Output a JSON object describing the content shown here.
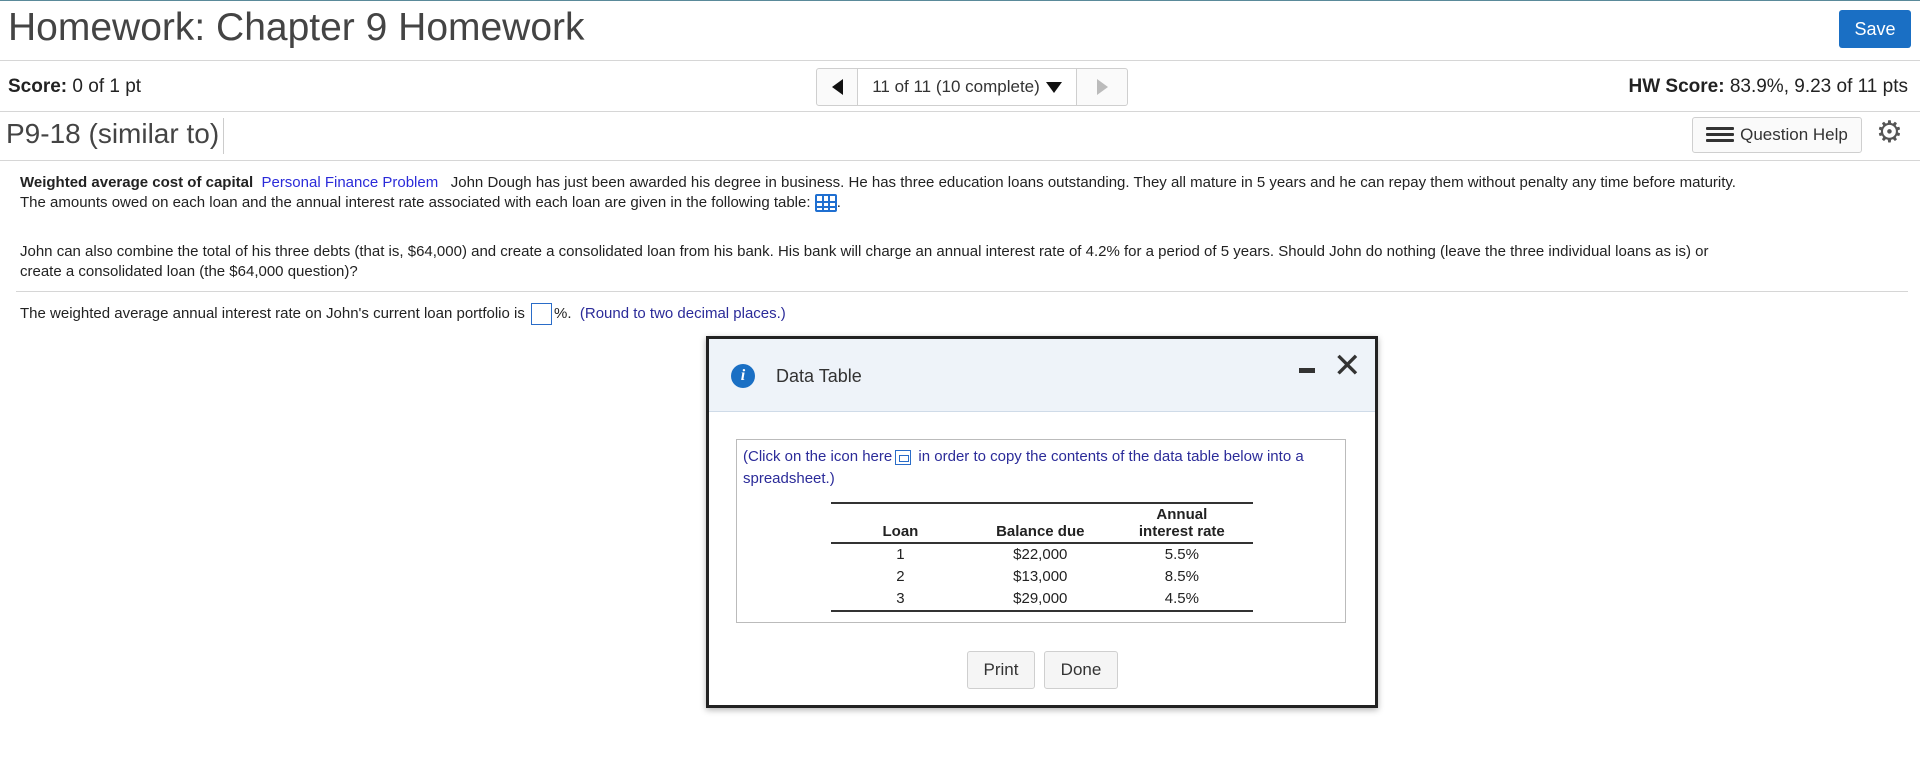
{
  "header": {
    "title": "Homework: Chapter 9 Homework",
    "save_label": "Save"
  },
  "score_row": {
    "score_label": "Score:",
    "score_value": "0 of 1 pt",
    "nav_text": "11 of 11 (10 complete)",
    "hw_label": "HW Score:",
    "hw_value": "83.9%, 9.23 of 11 pts"
  },
  "question_row": {
    "id": "P9-18 (similar to)",
    "help_label": "Question Help"
  },
  "problem": {
    "topic": "Weighted average cost of capital",
    "category": "Personal Finance Problem",
    "line1": "John Dough has just been awarded his degree in business.  He has three education loans outstanding.  They all mature in 5 years and he can repay them without penalty any time before maturity.",
    "line2": "The amounts owed on each loan and the annual interest rate associated with each loan are given in the following table:",
    "line2_end": ".",
    "para2_line1": "John can also combine the total of his three debts (that is, $64,000) and create a consolidated loan from his bank.  His bank will charge an annual interest rate of 4.2% for a period of 5 years.  Should John do nothing (leave the three individual loans as is) or",
    "para2_line2": "create a consolidated loan (the $64,000 question)?",
    "question_before": "The weighted average annual interest rate on John's current loan portfolio is",
    "question_after": "%.",
    "hint": "(Round to two decimal places.)"
  },
  "dialog": {
    "title": "Data Table",
    "copy_note_before": "(Click on the icon  here",
    "copy_note_after": " in order to copy the contents of the data table below into a spreadsheet.)",
    "columns": {
      "loan": "Loan",
      "balance": "Balance due",
      "rate_line1": "Annual",
      "rate_line2": "interest rate"
    },
    "rows": [
      {
        "loan": "1",
        "balance": "$22,000",
        "rate": "5.5%"
      },
      {
        "loan": "2",
        "balance": "$13,000",
        "rate": "8.5%"
      },
      {
        "loan": "3",
        "balance": "$29,000",
        "rate": "4.5%"
      }
    ],
    "print_label": "Print",
    "done_label": "Done"
  },
  "icons": {
    "nav_prev": "triangle-left",
    "nav_next": "triangle-right",
    "dropdown": "triangle-down",
    "question_help": "list-icon",
    "settings": "gear-icon",
    "data_table": "table-icon",
    "info": "info-icon",
    "minimize": "minimize-icon",
    "close": "close-icon",
    "copy": "copy-icon"
  },
  "colors": {
    "save_button": "#1a6fc4",
    "link_blue": "#2b2bd9",
    "hint": "#2b2b99",
    "dialog_header": "#eef3f9"
  }
}
